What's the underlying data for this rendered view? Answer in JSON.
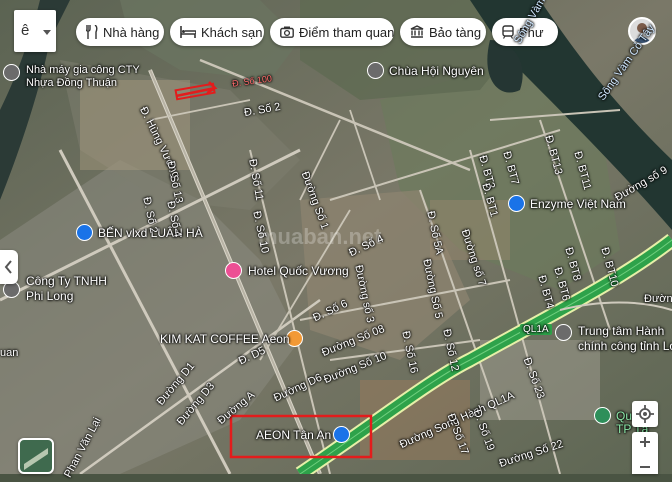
{
  "search": {
    "value": "ê"
  },
  "chips": [
    {
      "label": "Nhà hàng",
      "icon": "restaurant-icon"
    },
    {
      "label": "Khách sạn",
      "icon": "hotel-icon"
    },
    {
      "label": "Điểm tham quan",
      "icon": "camera-icon"
    },
    {
      "label": "Bảo tàng",
      "icon": "museum-icon"
    },
    {
      "label": "Phư",
      "icon": "transit-icon"
    }
  ],
  "places": {
    "factory": [
      "Nhà máy gia công CTY",
      "Nhựa Đồng Thuận"
    ],
    "pagoda": "Chùa Hội Nguyên",
    "ben": "BẾN vlxd LUÂN HÀ",
    "congty": [
      "Công Ty TNHH",
      "Phi Long"
    ],
    "hotel": "Hotel Quốc Vương",
    "kimkat": "KIM KAT COFFEE Aeon",
    "aeon": "AEON Tân An",
    "enzyme": "Enzyme Việt Nam",
    "trungtam": [
      "Trung tâm Hành",
      "chính công tỉnh Lo"
    ],
    "quang": [
      "Quản",
      "TP Tâ"
    ]
  },
  "streets": {
    "hungvuong": "Đ. Hùng Vương",
    "so2a": "Đ. Số 2",
    "so11": "Đ. Số 11",
    "so13": "Đ. Số 13",
    "so2b": "Đ. Số 2",
    "so4a": "Đ. Số 4",
    "so1": "Đường Số 1",
    "so10a": "Đ. Số 10",
    "so4b": "Đ. Số 4",
    "so3": "Đường số 3",
    "so6": "Đ. Số 6",
    "so08": "Đường Số 08",
    "so10b": "Đường Số 10",
    "d5": "Đ. D5",
    "d6": "Đường D6",
    "d1": "Đường D1",
    "d3": "Đường D3",
    "a1": "Đường A",
    "so5a": "Đ. Số 5A",
    "so7": "Đường số 7",
    "so5": "Đường Số 5",
    "so12": "Đ. Số 12",
    "so16": "Đ. Số 16",
    "bt13": "Đ. BT13",
    "bt11": "Đ. BT11",
    "bt7": "Đ. BT7",
    "bt3": "Đ. BT3",
    "bt1": "Đ. BT1",
    "bt10": "Đ. BT10",
    "bt8": "Đ. BT8",
    "bt6": "Đ. BT6",
    "bt4": "Đ. BT4",
    "soc9": "Đường số 9",
    "song": "Sông Vàm Cỏ Tây",
    "song2": "Sông Vàm Cỏ Tâ",
    "ql1a": "QL1A",
    "duong": "Đường",
    "songhanh": "Đường Song Hành QL1A",
    "s23": "Đ. Số 23",
    "s19": "Đ. Số 19",
    "s22": "Đường Số 22",
    "s17": "Đ. Số 17",
    "phanvanlai": "Phan Văn Lại",
    "uan": "uan",
    "redtext": "Đ. Số 100"
  },
  "colors": {
    "highway": "#2ea24a",
    "highwayEdge": "#e6f0a8",
    "annotation": "#e31c1c"
  },
  "watermark": "muaban.net"
}
